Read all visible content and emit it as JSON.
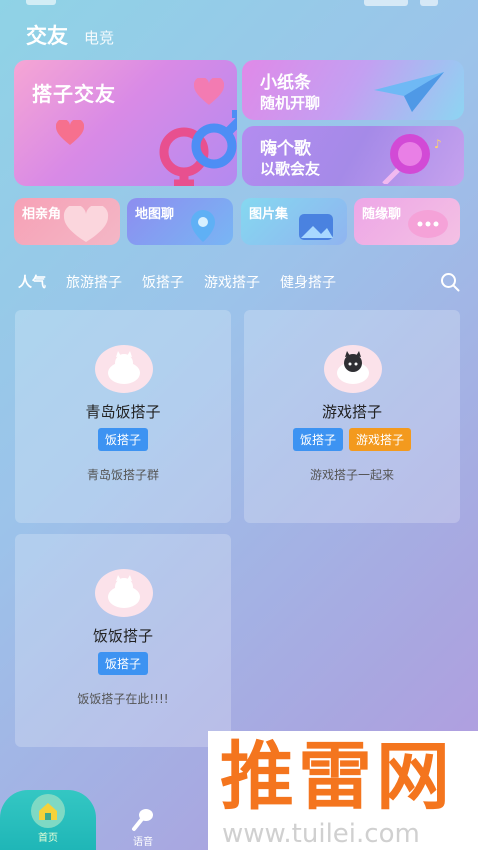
{
  "header": {
    "tab_main": "交友",
    "tab_sub": "电竞"
  },
  "banners": {
    "big": {
      "title": "搭子交友"
    },
    "note": {
      "title": "小纸条",
      "subtitle": "随机开聊"
    },
    "song": {
      "title": "嗨个歌",
      "subtitle": "以歌会友"
    }
  },
  "shortcuts": [
    {
      "label": "相亲角"
    },
    {
      "label": "地图聊"
    },
    {
      "label": "图片集"
    },
    {
      "label": "随缘聊"
    }
  ],
  "categories": [
    "人气",
    "旅游搭子",
    "饭搭子",
    "游戏搭子",
    "健身搭子"
  ],
  "groups": [
    {
      "name": "青岛饭搭子",
      "tags": [
        "饭搭子"
      ],
      "desc": "青岛饭搭子群"
    },
    {
      "name": "游戏搭子",
      "tags": [
        "饭搭子",
        "游戏搭子"
      ],
      "desc": "游戏搭子一起来"
    },
    {
      "name": "饭饭搭子",
      "tags": [
        "饭搭子"
      ],
      "desc": "饭饭搭子在此!!!!"
    }
  ],
  "tabbar": {
    "home": "首页",
    "voice": "语音"
  },
  "watermark": {
    "brand": "推雷网",
    "url": "www.tuilei.com"
  },
  "colors": {
    "tag_blue": "#3d93f2",
    "tag_orange": "#f39a1e",
    "home_tab": "#1fb6b7"
  },
  "icons": [
    "search-icon",
    "home-icon",
    "microphone-icon",
    "heart-icon",
    "paper-plane-icon",
    "lollipop-icon",
    "map-pin-icon",
    "picture-icon",
    "chat-bubble-icon",
    "gender-symbol-icon",
    "cat-avatar-icon"
  ]
}
